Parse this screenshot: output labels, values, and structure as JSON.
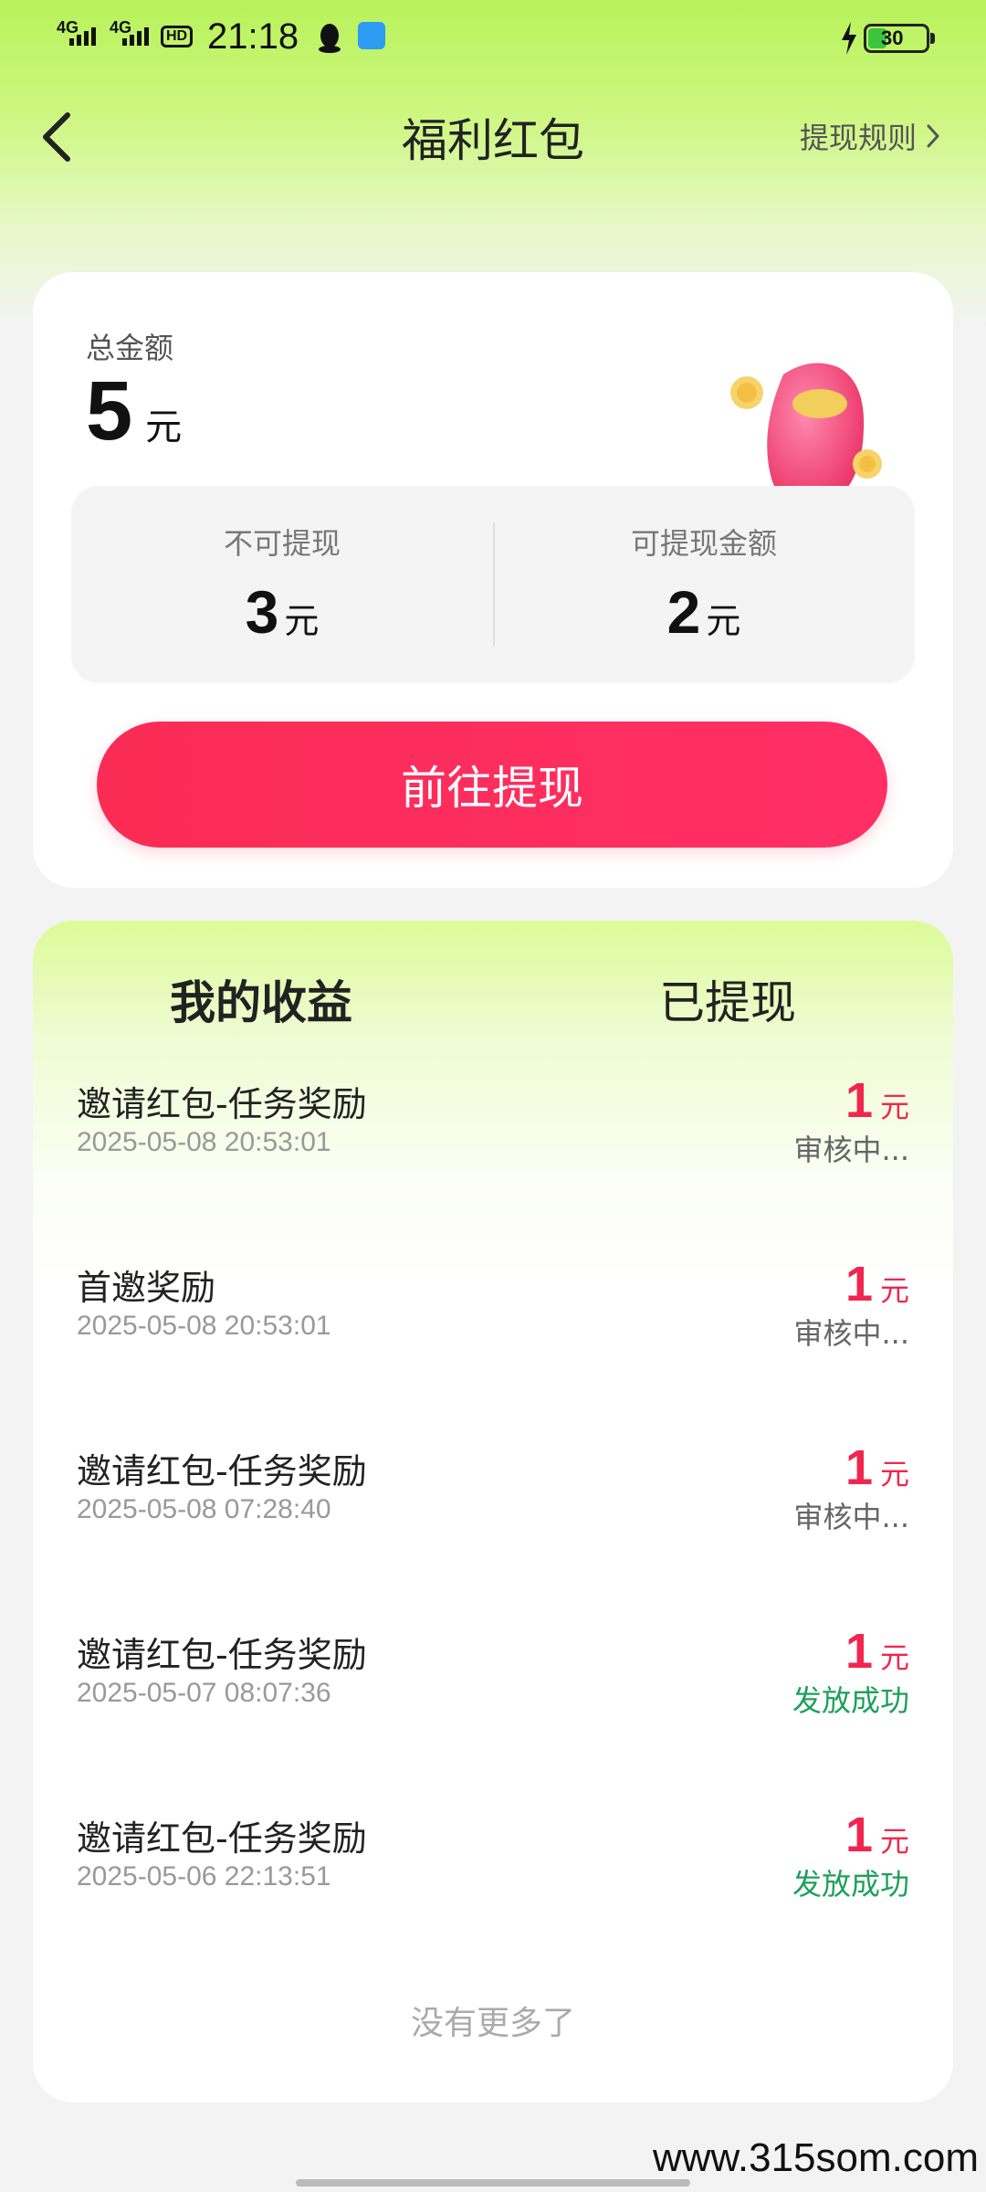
{
  "status_bar": {
    "network1": "4G",
    "network2": "4G",
    "hd": "HD",
    "time": "21:18",
    "battery": "30"
  },
  "nav": {
    "title": "福利红包",
    "rules_label": "提现规则"
  },
  "summary": {
    "total_label": "总金额",
    "total_value": "5",
    "unit": "元",
    "non_withdrawable_label": "不可提现",
    "non_withdrawable_value": "3",
    "withdrawable_label": "可提现金额",
    "withdrawable_value": "2",
    "withdraw_button": "前往提现"
  },
  "tabs": {
    "earnings": "我的收益",
    "withdrawn": "已提现"
  },
  "records": [
    {
      "title": "邀请红包-任务奖励",
      "time": "2025-05-08 20:53:01",
      "amount": "1",
      "unit": "元",
      "status": "审核中..."
    },
    {
      "title": "首邀奖励",
      "time": "2025-05-08 20:53:01",
      "amount": "1",
      "unit": "元",
      "status": "审核中..."
    },
    {
      "title": "邀请红包-任务奖励",
      "time": "2025-05-08 07:28:40",
      "amount": "1",
      "unit": "元",
      "status": "审核中..."
    },
    {
      "title": "邀请红包-任务奖励",
      "time": "2025-05-07 08:07:36",
      "amount": "1",
      "unit": "元",
      "status": "发放成功"
    },
    {
      "title": "邀请红包-任务奖励",
      "time": "2025-05-06 22:13:51",
      "amount": "1",
      "unit": "元",
      "status": "发放成功"
    }
  ],
  "footer": {
    "no_more": "没有更多了"
  },
  "watermark": "www.315som.com",
  "colors": {
    "accent_red": "#f0264f",
    "success_green": "#1ea05a",
    "header_green": "#b8f25a"
  }
}
